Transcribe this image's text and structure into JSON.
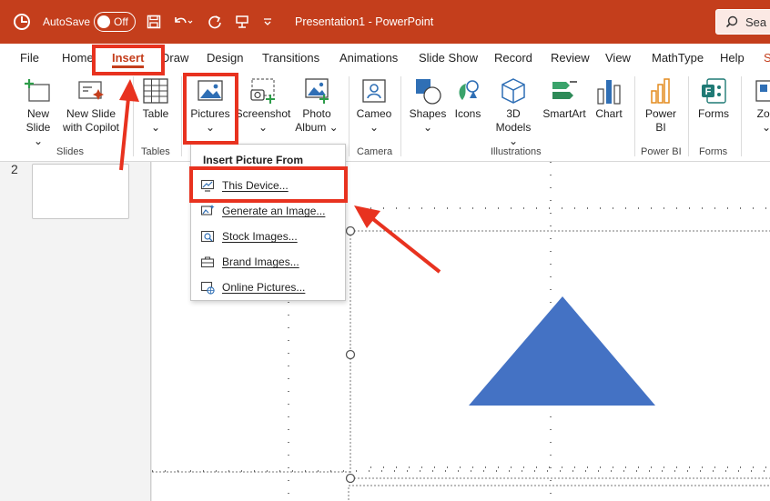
{
  "titlebar": {
    "autosave_label": "AutoSave",
    "autosave_state": "Off",
    "doc_title": "Presentation1  -  PowerPoint",
    "search_placeholder": "Sea"
  },
  "tabs": [
    "File",
    "Home",
    "Insert",
    "Draw",
    "Design",
    "Transitions",
    "Animations",
    "Slide Show",
    "Record",
    "Review",
    "View",
    "MathType",
    "Help",
    "S"
  ],
  "active_tab": "Insert",
  "ribbon": {
    "new_slide": [
      "New",
      "Slide ⌄"
    ],
    "new_slide_copilot": [
      "New Slide",
      "with Copilot"
    ],
    "table": [
      "Table",
      "⌄"
    ],
    "pictures": [
      "Pictures",
      "⌄"
    ],
    "screenshot": [
      "Screenshot",
      "⌄"
    ],
    "photo_album": [
      "Photo",
      "Album ⌄"
    ],
    "cameo": [
      "Cameo",
      "⌄"
    ],
    "shapes": [
      "Shapes",
      "⌄"
    ],
    "icons": [
      "Icons"
    ],
    "models": [
      "3D",
      "Models ⌄"
    ],
    "smartart": [
      "SmartArt"
    ],
    "chart": [
      "Chart"
    ],
    "powerbi": [
      "Power",
      "BI"
    ],
    "forms": [
      "Forms"
    ],
    "zoom": [
      "Zoo",
      "⌄"
    ],
    "groups": {
      "slides": "Slides",
      "tables": "Tables",
      "camera": "Camera",
      "illustrations": "Illustrations",
      "powerbi": "Power BI",
      "forms": "Forms"
    }
  },
  "thumbpane": {
    "slide_number": "2"
  },
  "dropdown": {
    "header": "Insert Picture From",
    "items": [
      "This Device...",
      "Generate an Image...",
      "Stock Images...",
      "Brand Images...",
      "Online Pictures..."
    ]
  },
  "colors": {
    "accent": "#c43e1c",
    "annotation": "#e8321f",
    "shape": "#4472c4"
  }
}
